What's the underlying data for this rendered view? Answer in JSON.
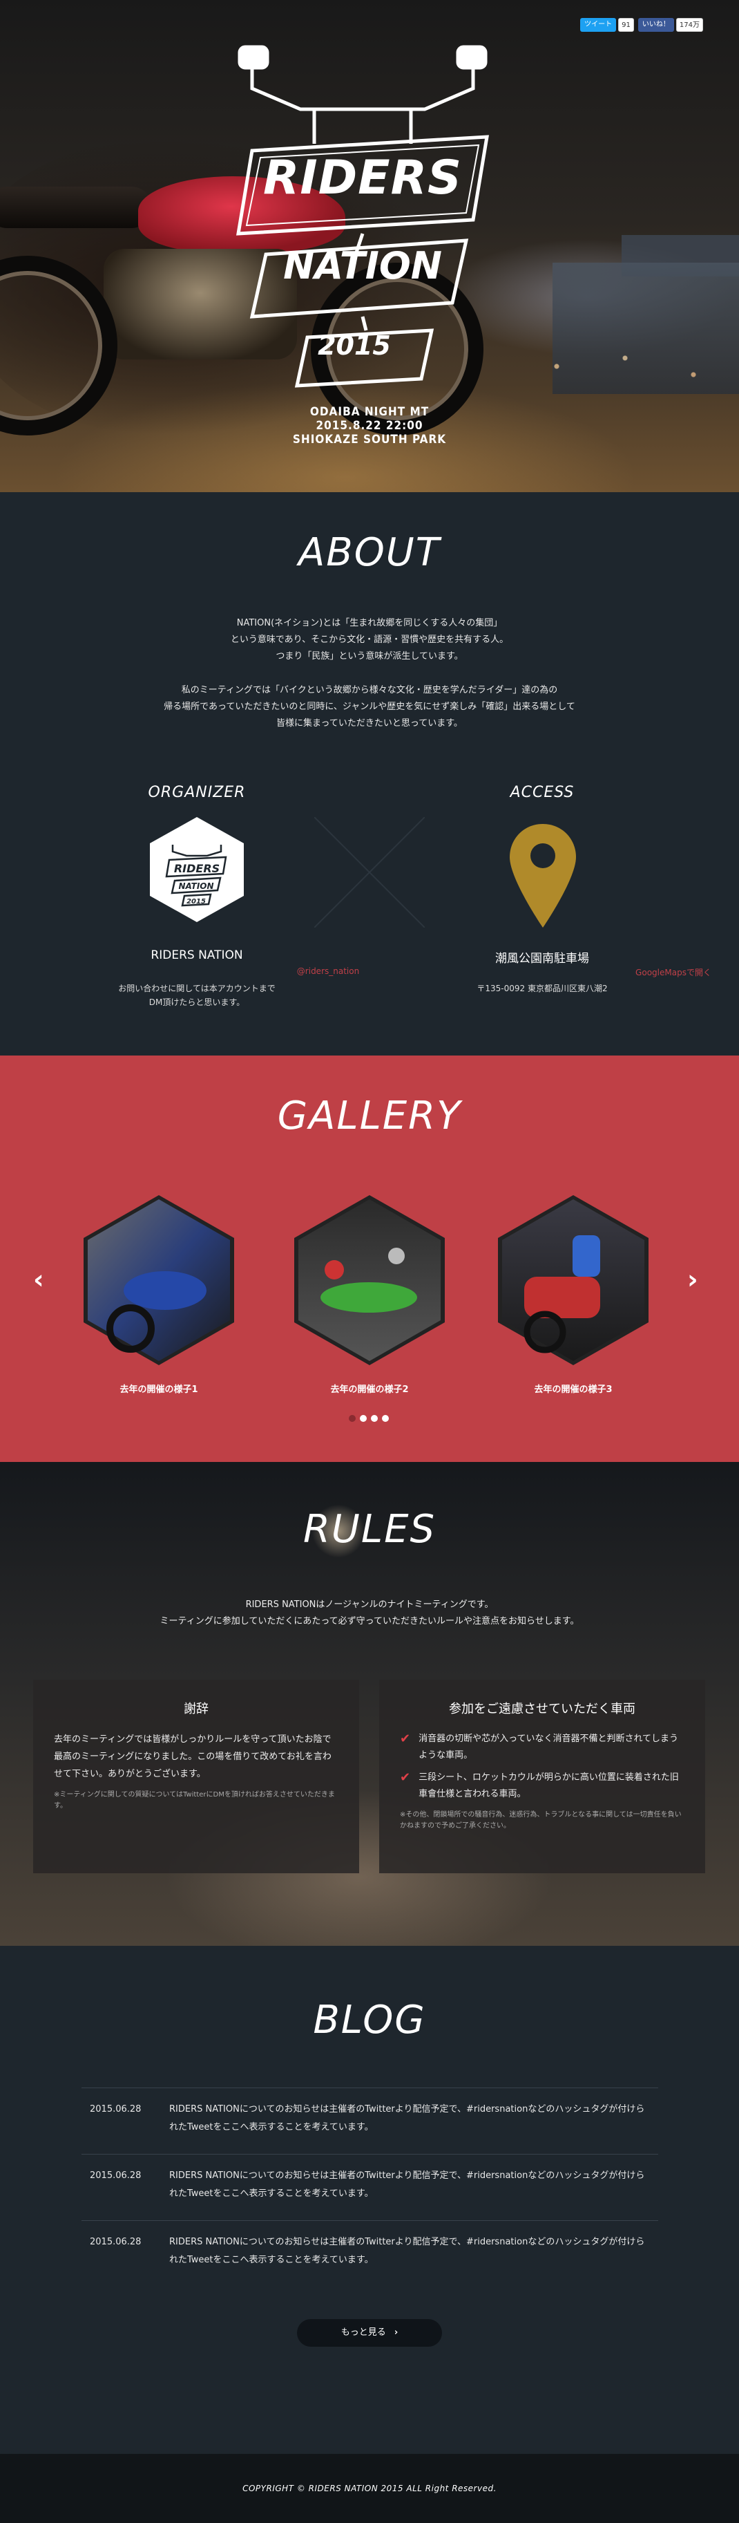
{
  "social": {
    "tweet_label": "ツイート",
    "tweet_count": "91",
    "like_label": "いいね！",
    "like_count": "174万"
  },
  "hero": {
    "logo_line1": "RIDERS",
    "logo_line2": "NATION",
    "logo_line3": "2015",
    "event_name": "ODAIBA NIGHT MT",
    "event_date": "2015.8.22 22:00",
    "event_place": "SHIOKAZE SOUTH PARK"
  },
  "about": {
    "title": "ABOUT",
    "para1": [
      "NATION(ネイション)とは「生まれ故郷を同じくする人々の集団」",
      "という意味であり、そこから文化・語源・習慣や歴史を共有する人。",
      "つまり「民族」という意味が派生しています。"
    ],
    "para2": [
      "私のミーティングでは「バイクという故郷から様々な文化・歴史を学んだライダー」達の為の",
      "帰る場所であっていただきたいのと同時に、ジャンルや歴史を気にせず楽しみ「確認」出来る場として",
      "皆様に集まっていただきたいと思っています。"
    ],
    "organizer": {
      "heading": "ORGANIZER",
      "name": "RIDERS NATION",
      "account": "@riders_nation",
      "desc1": "お問い合わせに関しては本アカウントまで",
      "desc2": "DM頂けたらと思います。"
    },
    "access": {
      "heading": "ACCESS",
      "name": "潮風公園南駐車場",
      "map_link": "GoogleMapsで開く",
      "address": "〒135-0092 東京都品川区東八潮2"
    }
  },
  "gallery": {
    "title": "GALLERY",
    "items": [
      {
        "caption": "去年の開催の様子1"
      },
      {
        "caption": "去年の開催の様子2"
      },
      {
        "caption": "去年の開催の様子3"
      }
    ],
    "prev_icon": "‹",
    "next_icon": "›"
  },
  "rules": {
    "title": "RULES",
    "intro1": "RIDERS NATIONはノージャンルのナイトミーティングです。",
    "intro2": "ミーティングに参加していただくにあたって必ず守っていただきたいルールや注意点をお知らせします。",
    "card1": {
      "heading": "謝辞",
      "body": "去年のミーティングでは皆様がしっかりルールを守って頂いたお陰で最高のミーティングになりました。この場を借りて改めてお礼を言わせて下さい。ありがとうございます。",
      "note": "※ミーティングに関しての質疑についてはTwitterにDMを頂ければお答えさせていただきます。"
    },
    "card2": {
      "heading": "参加をご遠慮させていただく車両",
      "item1": "消音器の切断や芯が入っていなく消音器不備と判断されてしまうような車両。",
      "item2": "三段シート、ロケットカウルが明らかに高い位置に装着された旧車會仕様と言われる車両。",
      "note": "※その他、閉鎖場所での騒音行為、迷惑行為、トラブルとなる事に関しては一切責任を負いかねますので予めご了承ください。"
    }
  },
  "blog": {
    "title": "BLOG",
    "posts": [
      {
        "date": "2015.06.28",
        "text": "RIDERS NATIONについてのお知らせは主催者のTwitterより配信予定で、#ridersnationなどのハッシュタグが付けられたTweetをここへ表示することを考えています。"
      },
      {
        "date": "2015.06.28",
        "text": "RIDERS NATIONについてのお知らせは主催者のTwitterより配信予定で、#ridersnationなどのハッシュタグが付けられたTweetをここへ表示することを考えています。"
      },
      {
        "date": "2015.06.28",
        "text": "RIDERS NATIONについてのお知らせは主催者のTwitterより配信予定で、#ridersnationなどのハッシュタグが付けられたTweetをここへ表示することを考えています。"
      }
    ],
    "more_label": "もっと見る",
    "more_icon": "›"
  },
  "footer": {
    "copyright": "COPYRIGHT © RIDERS NATION 2015 ALL Right Reserved."
  },
  "colors": {
    "accent_red": "#bf4046",
    "dark_bg": "#1e262d",
    "pin_gold": "#b08a2a"
  }
}
